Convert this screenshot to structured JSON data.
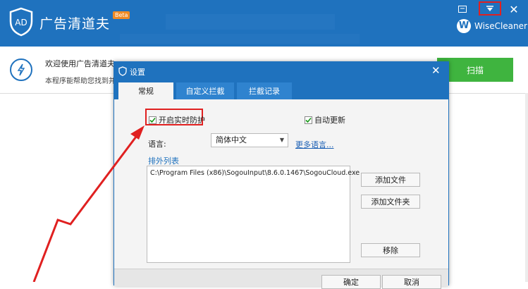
{
  "app": {
    "title": "广告清道夫",
    "beta": "Beta",
    "brand": "WiseCleaner",
    "brand_letter": "W",
    "logo_text": "AD",
    "close_glyph": "✕"
  },
  "welcome": {
    "title": "欢迎使用广告清道夫",
    "description": "本程序能帮助您找到并",
    "scan_label": "扫描"
  },
  "dialog": {
    "title": "设置",
    "tabs": [
      {
        "label": "常规"
      },
      {
        "label": "自定义拦截"
      },
      {
        "label": "拦截记录"
      }
    ],
    "realtime_protection": {
      "label": "开启实时防护",
      "checked": true
    },
    "auto_update": {
      "label": "自动更新",
      "checked": true
    },
    "language_label": "语言:",
    "language_value": "简体中文",
    "more_languages": "更多语言...",
    "exclusion_label": "排外列表",
    "exclusions": [
      "C:\\Program Files (x86)\\SogouInput\\8.6.0.1467\\SogouCloud.exe"
    ],
    "add_file": "添加文件",
    "add_folder": "添加文件夹",
    "remove": "移除",
    "ok": "确定",
    "cancel": "取消"
  },
  "colors": {
    "header_blue": "#1f72be",
    "scan_green": "#3fb43f",
    "highlight_red": "#e02020"
  }
}
